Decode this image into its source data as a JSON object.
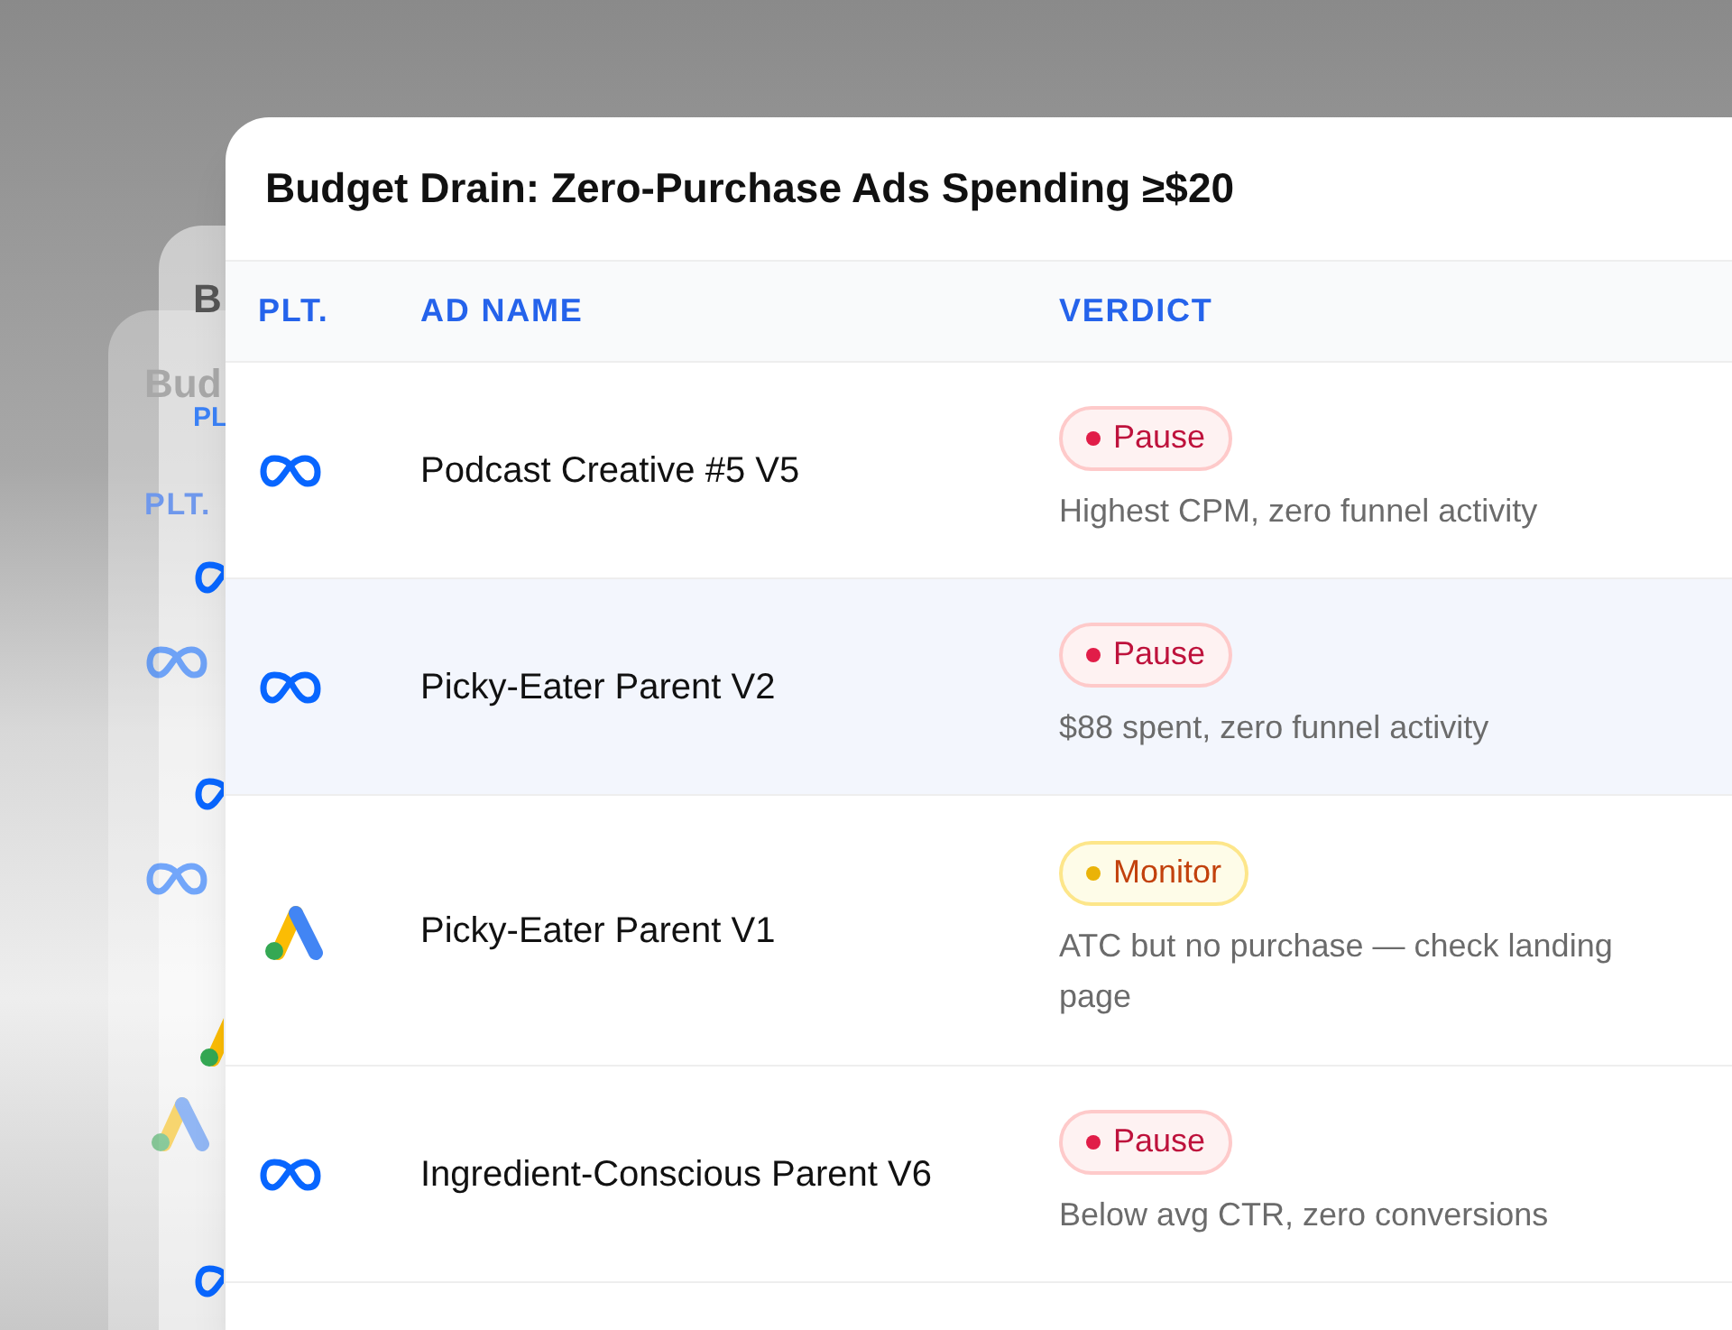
{
  "background_cards": [
    {
      "title": "B",
      "header": "PL",
      "logos": [
        {
          "kind": "infinity"
        },
        {
          "kind": "infinity"
        },
        {
          "kind": "triangle"
        },
        {
          "kind": "infinity"
        }
      ]
    },
    {
      "title": "Bud",
      "header": "PLT.",
      "logos": [
        {
          "kind": "infinity"
        },
        {
          "kind": "infinity"
        },
        {
          "kind": "triangle"
        }
      ]
    }
  ],
  "card": {
    "title": "Budget Drain: Zero-Purchase Ads Spending ≥$20",
    "columns": [
      "PLT.",
      "AD NAME",
      "VERDICT"
    ],
    "rows": [
      {
        "logo": {
          "kind": "infinity"
        },
        "ad_name": "Podcast Creative #5 V5",
        "verdict": {
          "kind": "pause",
          "label": "Pause"
        },
        "note": "Highest CPM, zero funnel activity",
        "selected": false
      },
      {
        "logo": {
          "kind": "infinity"
        },
        "ad_name": "Picky-Eater Parent V2",
        "verdict": {
          "kind": "pause",
          "label": "Pause"
        },
        "note": "$88 spent, zero funnel activity",
        "selected": true
      },
      {
        "logo": {
          "kind": "triangle"
        },
        "ad_name": "Picky-Eater Parent V1",
        "verdict": {
          "kind": "monitor",
          "label": "Monitor"
        },
        "note": "ATC but no purchase — check landing page",
        "selected": false
      },
      {
        "logo": {
          "kind": "infinity"
        },
        "ad_name": "Ingredient-Conscious Parent V6",
        "verdict": {
          "kind": "pause",
          "label": "Pause"
        },
        "note": "Below avg CTR, zero conversions",
        "selected": false
      }
    ]
  }
}
